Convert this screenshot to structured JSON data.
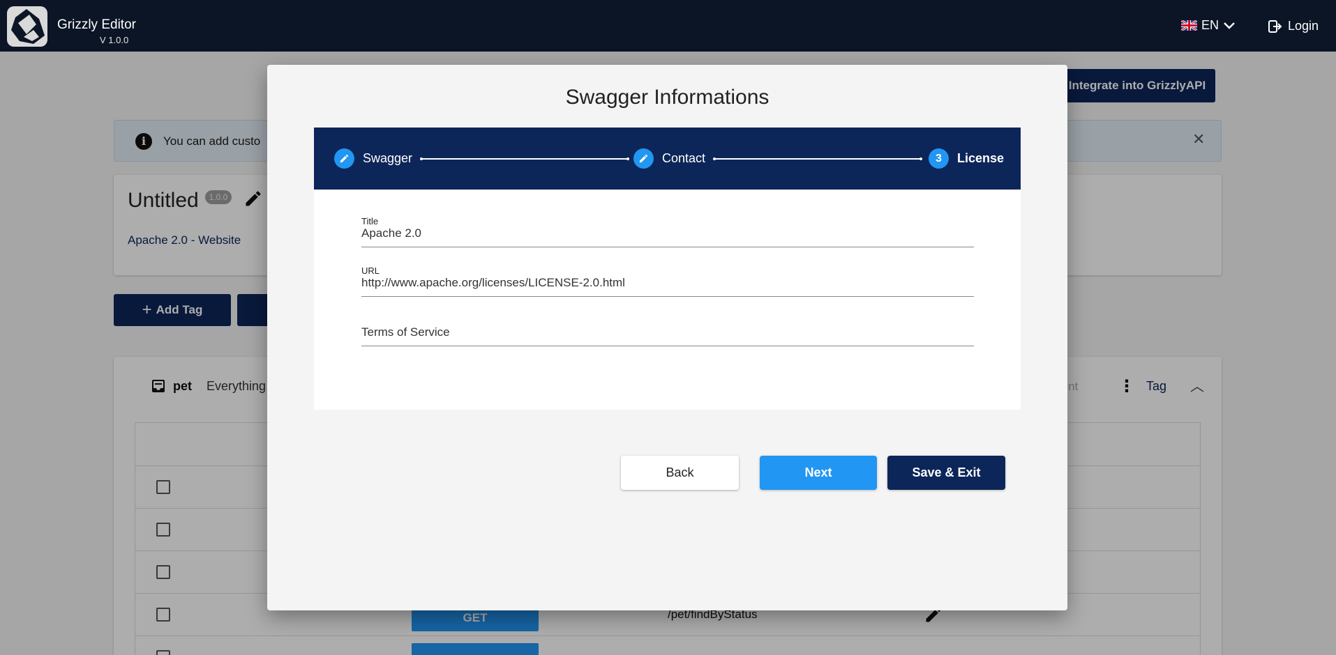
{
  "header": {
    "app_title": "Grizzly Editor",
    "version": "V 1.0.0",
    "language": "EN",
    "login_label": "Login"
  },
  "page": {
    "integrate_label": "Integrate into GrizzlyAPI",
    "info_text": "You can add custo",
    "doc_title": "Untitled",
    "doc_version": "1.0.0",
    "license_link": "Apache 2.0 - Website",
    "add_tag_label": "Add Tag",
    "tag": {
      "name": "pet",
      "description": "Everything",
      "point_label": "oint",
      "tag_label": "Tag"
    },
    "rows": [
      {
        "method": "",
        "path": ""
      },
      {
        "method": "",
        "path": ""
      },
      {
        "method": "",
        "path": ""
      },
      {
        "method": "GET",
        "path": "/pet/findByStatus"
      }
    ]
  },
  "modal": {
    "title": "Swagger Informations",
    "steps": [
      {
        "label": "Swagger",
        "marker": "edit-icon"
      },
      {
        "label": "Contact",
        "marker": "edit-icon"
      },
      {
        "label": "License",
        "marker": "3"
      }
    ],
    "fields": {
      "title": {
        "label": "Title",
        "value": "Apache 2.0"
      },
      "url": {
        "label": "URL",
        "value": "http://www.apache.org/licenses/LICENSE-2.0.html"
      },
      "terms": {
        "label": "",
        "placeholder": "Terms of Service"
      }
    },
    "buttons": {
      "back": "Back",
      "next": "Next",
      "save": "Save & Exit"
    }
  },
  "colors": {
    "navy": "#0d2659",
    "accent": "#2196f3",
    "topbar": "#0b1526"
  }
}
